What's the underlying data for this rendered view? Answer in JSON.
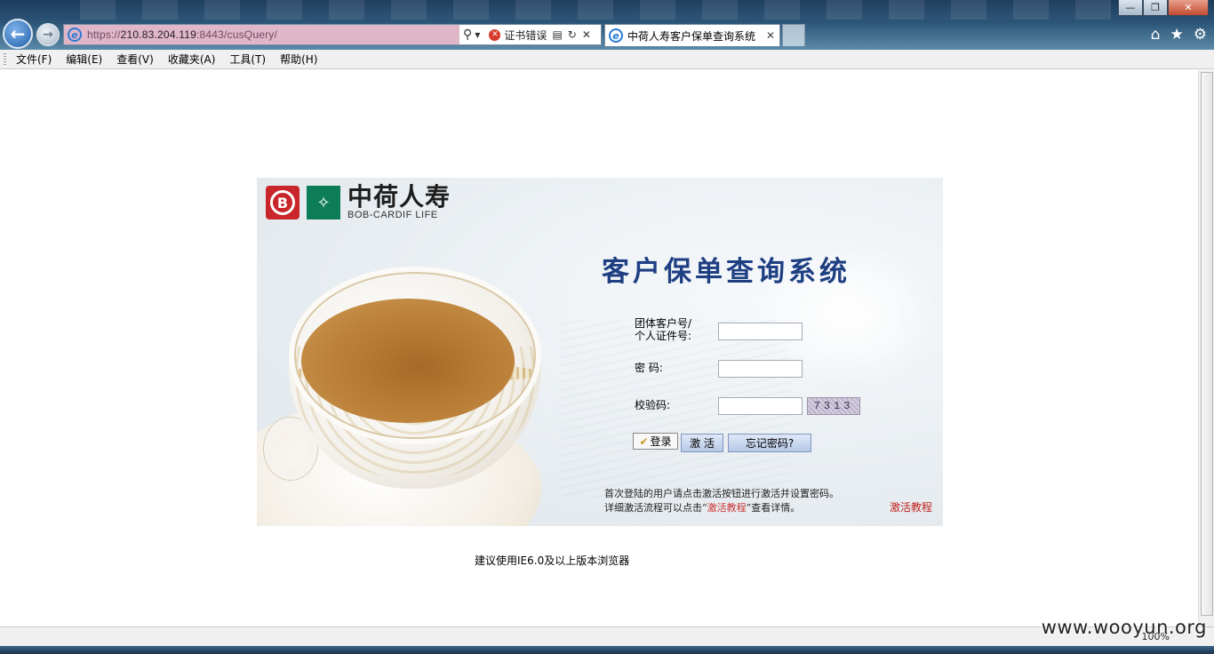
{
  "browser": {
    "url_prefix": "https://",
    "url_host": "210.83.204.119",
    "url_rest": ":8443/cusQuery/",
    "cert_error": "证书错误",
    "tab_title": "中荷人寿客户保单查询系统",
    "menu": [
      "文件(F)",
      "编辑(E)",
      "查看(V)",
      "收藏夹(A)",
      "工具(T)",
      "帮助(H)"
    ],
    "zoom": "100%"
  },
  "logo": {
    "cn": "中荷人寿",
    "en": "BOB-CARDIF LIFE"
  },
  "login": {
    "system_title": "客户保单查询系统",
    "id_label_line1": "团体客户号/",
    "id_label_line2": "个人证件号:",
    "password_label": "密  码:",
    "captcha_label": "校验码:",
    "captcha_value": "7313",
    "id_value": "",
    "password_value": "",
    "captcha_input_value": "",
    "login_button": "登录",
    "activate_button": "激 活",
    "forgot_button": "忘记密码?",
    "notice_line1": "首次登陆的用户请点击激活按钮进行激活并设置密码。",
    "notice_line2_pre": "详细激活流程可以点击“",
    "notice_line2_link": "激活教程",
    "notice_line2_post": "”查看详情。",
    "tutorial_link": "激活教程"
  },
  "footer": {
    "browser_tip": "建议使用IE6.0及以上版本浏览器"
  },
  "watermark": "www.wooyun.org"
}
